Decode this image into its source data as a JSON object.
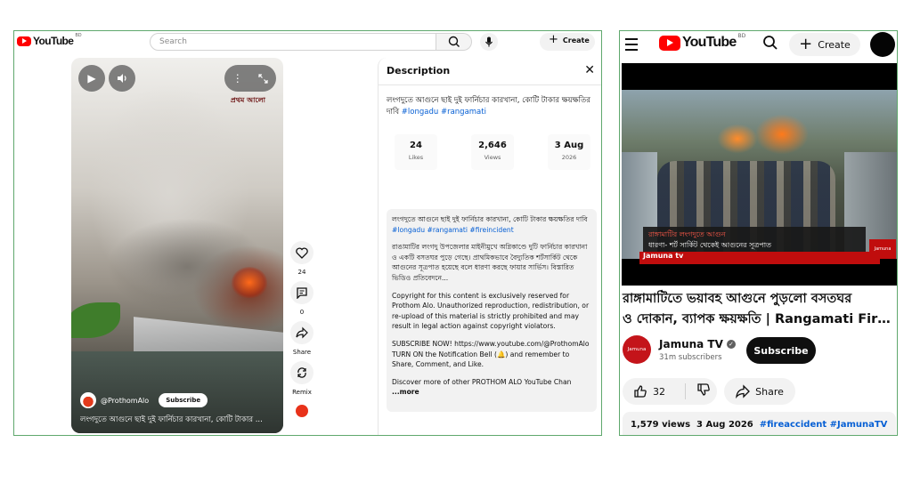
{
  "desktop": {
    "logo": {
      "word": "YouTube",
      "country": "BD"
    },
    "search": {
      "placeholder": "Search"
    },
    "create_label": "Create",
    "player": {
      "watermark": "প্রথম আলো",
      "channel": "@ProthomAlo",
      "subscribe_label": "Subscribe",
      "overlay_title": "লংগদুতে আগুনে ছাই দুই ফার্নিচার কারখানা, কোটি টাকার ..."
    },
    "actions": {
      "like_count": "24",
      "comment_count": "0",
      "share_label": "Share",
      "remix_label": "Remix"
    },
    "description": {
      "heading": "Description",
      "title_text": "লংগদুতে আগুনে ছাই দুই ফার্নিচার কারখানা, কোটি টাকার ক্ষয়ক্ষতির দাবি ",
      "title_tags": "#longadu #rangamati",
      "stats": [
        {
          "value": "24",
          "label": "Likes"
        },
        {
          "value": "2,646",
          "label": "Views"
        },
        {
          "value": "3 Aug",
          "label": "2026"
        }
      ],
      "body_title": "লংগদুতে আগুনে ছাই দুই ফার্নিচার কারখানা, কোটি টাকার ক্ষয়ক্ষতির দাবি ",
      "body_tags": "#longadu #rangamati #fireincident",
      "body_para1": "রাঙামাটির লংগদু উপজেলার মাইনীমুখে অগ্নিকাণ্ডে দুটি ফার্নিচার কারখানা ও একটি বসতঘর পুড়ে গেছে। প্রাথমিকভাবে বৈদ্যুতিক শর্টসার্কিট থেকে আগুনের সূত্রপাত হয়েছে বলে ধারণা করছে ফায়ার সার্ভিস। বিস্তারিত ভিডিও প্রতিবেদনে...",
      "body_para2": "Copyright for this content is exclusively reserved for Prothom Alo. Unauthorized reproduction, redistribution, or re-upload of this material is strictly prohibited and may result in legal action against copyright violators.",
      "body_para3": "SUBSCRIBE NOW! https://www.youtube.com/@ProthomAlo TURN ON the Notification Bell (🔔) and remember to Share, Comment, and Like.",
      "body_para4": "Discover more of other PROTHOM ALO YouTube Chan",
      "more_label": "...more"
    }
  },
  "mobile": {
    "logo": {
      "word": "YouTube",
      "country": "BD"
    },
    "create_label": "Create",
    "video": {
      "chyron_line1": "রাঙ্গামাটির লংগদুতে আগুন",
      "chyron_line2": "ধারণা- শর্ট সার্কিট থেকেই আগুনের সূত্রপাত",
      "brand": "Jamuna tv",
      "corner_badge": "Jamuna"
    },
    "title_line1": "রাঙ্গামাটিতে ভয়াবহ আগুনে পুড়লো বসতঘর",
    "title_line2": "ও দোকান, ব্যাপক ক্ষয়ক্ষতি | Rangamati Fire ...",
    "channel": {
      "avatar_text": "Jamuna",
      "name": "Jamuna TV",
      "subscribers": "31m subscribers",
      "subscribe_label": "Subscribe"
    },
    "likes": "32",
    "share_label": "Share",
    "meta_views": "1,579 views",
    "meta_date": "3 Aug 2026",
    "meta_tags": "#fireaccident #JamunaTV"
  }
}
